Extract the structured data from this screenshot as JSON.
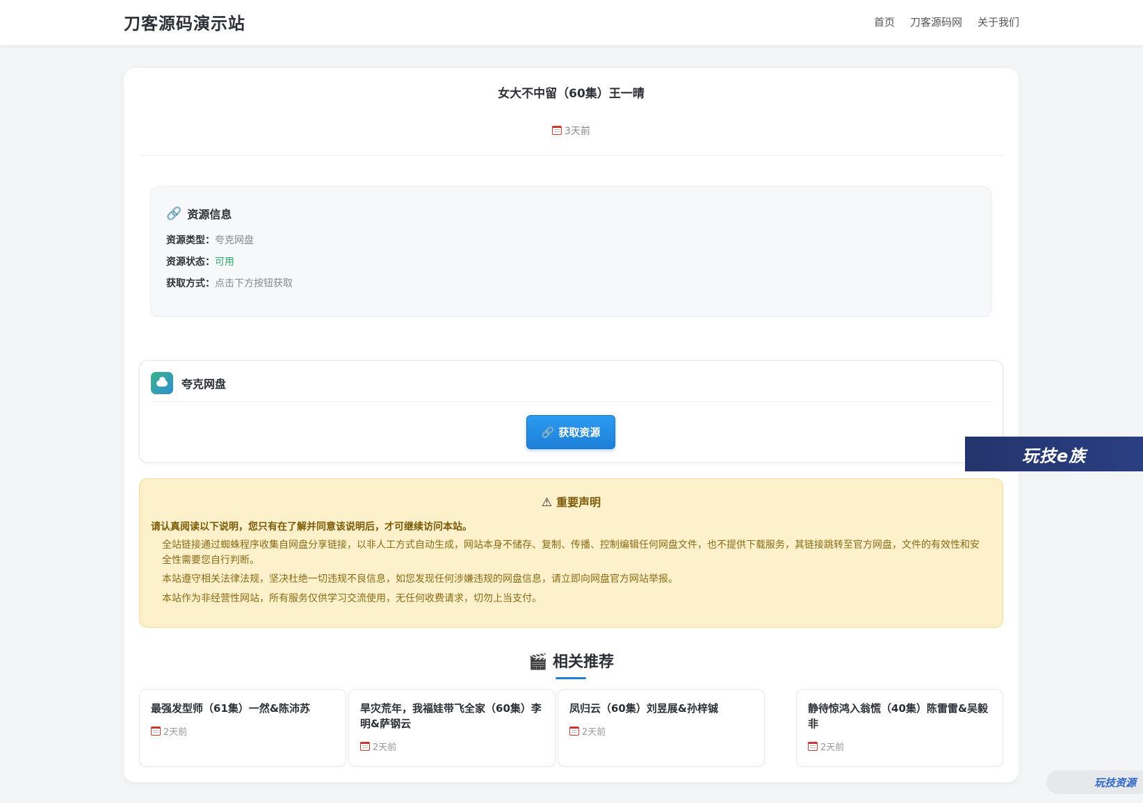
{
  "site": {
    "brand": "刀客源码演示站"
  },
  "nav": [
    {
      "label": "首页"
    },
    {
      "label": "刀客源码网"
    },
    {
      "label": "关于我们"
    }
  ],
  "post": {
    "title": "女大不中留（60集）王一晴",
    "date": "3天前"
  },
  "resource_info": {
    "heading": "资源信息",
    "rows": [
      {
        "key": "资源类型：",
        "value": "夸克网盘",
        "status": "normal"
      },
      {
        "key": "资源状态：",
        "value": "可用",
        "status": "ok"
      },
      {
        "key": "获取方式：",
        "value": "点击下方按钮获取",
        "status": "normal"
      }
    ]
  },
  "quark": {
    "name": "夸克网盘",
    "button_label": "获取资源"
  },
  "notice": {
    "title": "重要声明",
    "lead": "请认真阅读以下说明，您只有在了解并同意该说明后，才可继续访问本站。",
    "paragraphs": [
      "全站链接通过蜘蛛程序收集自网盘分享链接，以非人工方式自动生成，网站本身不储存、复制、传播、控制编辑任何网盘文件，也不提供下载服务，其链接跳转至官方网盘，文件的有效性和安全性需要您自行判断。",
      "本站遵守相关法律法规，坚决杜绝一切违规不良信息，如您发现任何涉嫌违规的网盘信息，请立即向网盘官方网站举报。",
      "本站作为非经营性网站，所有服务仅供学习交流使用，无任何收费请求，切勿上当支付。"
    ]
  },
  "related": {
    "title": "相关推荐",
    "items": [
      {
        "title": "最强发型师（61集）一然&陈沛苏",
        "date": "2天前"
      },
      {
        "title": "旱灾荒年，我福娃带飞全家（60集）李明&萨钢云",
        "date": "2天前"
      },
      {
        "title": "凤归云（60集）刘昱展&孙梓铖",
        "date": "2天前"
      },
      {
        "title": "静待惊鸿入翁慌（40集）陈雷雷&吴毅非",
        "date": "2天前"
      }
    ]
  },
  "watermarks": {
    "badge1": "玩技e族",
    "badge2": "玩技资源"
  },
  "colors": {
    "accent": "#1e7fd8",
    "status_ok": "#2ba86a",
    "notice_bg": "#fdf1cc"
  }
}
